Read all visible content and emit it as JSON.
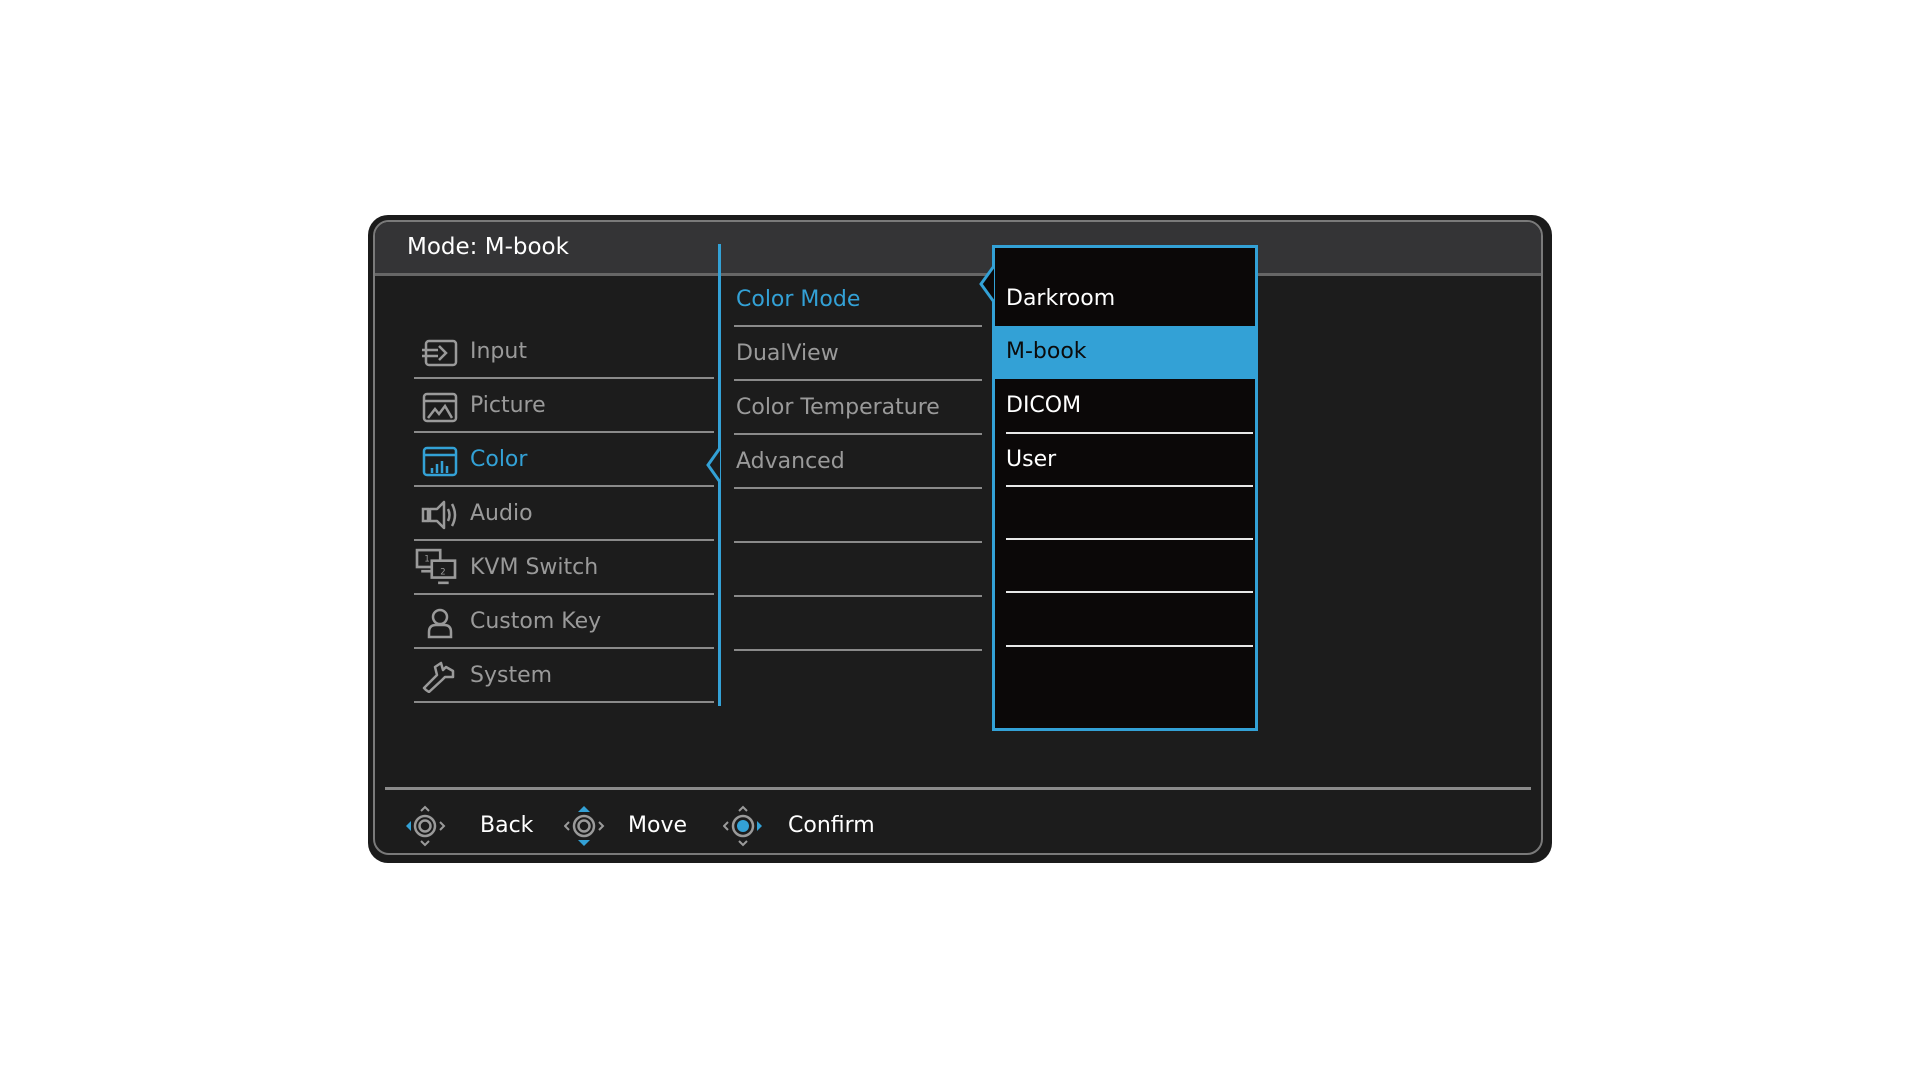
{
  "header": {
    "title": "Mode: M-book"
  },
  "main_menu": {
    "items": [
      {
        "label": "Input",
        "icon": "input-icon",
        "active": false
      },
      {
        "label": "Picture",
        "icon": "picture-icon",
        "active": false
      },
      {
        "label": "Color",
        "icon": "color-icon",
        "active": true
      },
      {
        "label": "Audio",
        "icon": "audio-icon",
        "active": false
      },
      {
        "label": "KVM Switch",
        "icon": "kvm-switch-icon",
        "active": false
      },
      {
        "label": "Custom Key",
        "icon": "custom-key-icon",
        "active": false
      },
      {
        "label": "System",
        "icon": "system-icon",
        "active": false
      }
    ]
  },
  "sub_menu": {
    "items": [
      {
        "label": "Color Mode",
        "active": true
      },
      {
        "label": "DualView",
        "active": false
      },
      {
        "label": "Color Temperature",
        "active": false
      },
      {
        "label": "Advanced",
        "active": false
      }
    ]
  },
  "options": {
    "items": [
      {
        "label": "Darkroom",
        "selected": false
      },
      {
        "label": "M-book",
        "selected": true
      },
      {
        "label": "DICOM",
        "selected": false
      },
      {
        "label": "User",
        "selected": false
      }
    ]
  },
  "footer": {
    "back_label": "Back",
    "move_label": "Move",
    "confirm_label": "Confirm"
  },
  "colors": {
    "accent": "#33a1d6",
    "background": "#1c1c1c",
    "header": "#343436",
    "text_inactive": "#9a9a9a"
  }
}
